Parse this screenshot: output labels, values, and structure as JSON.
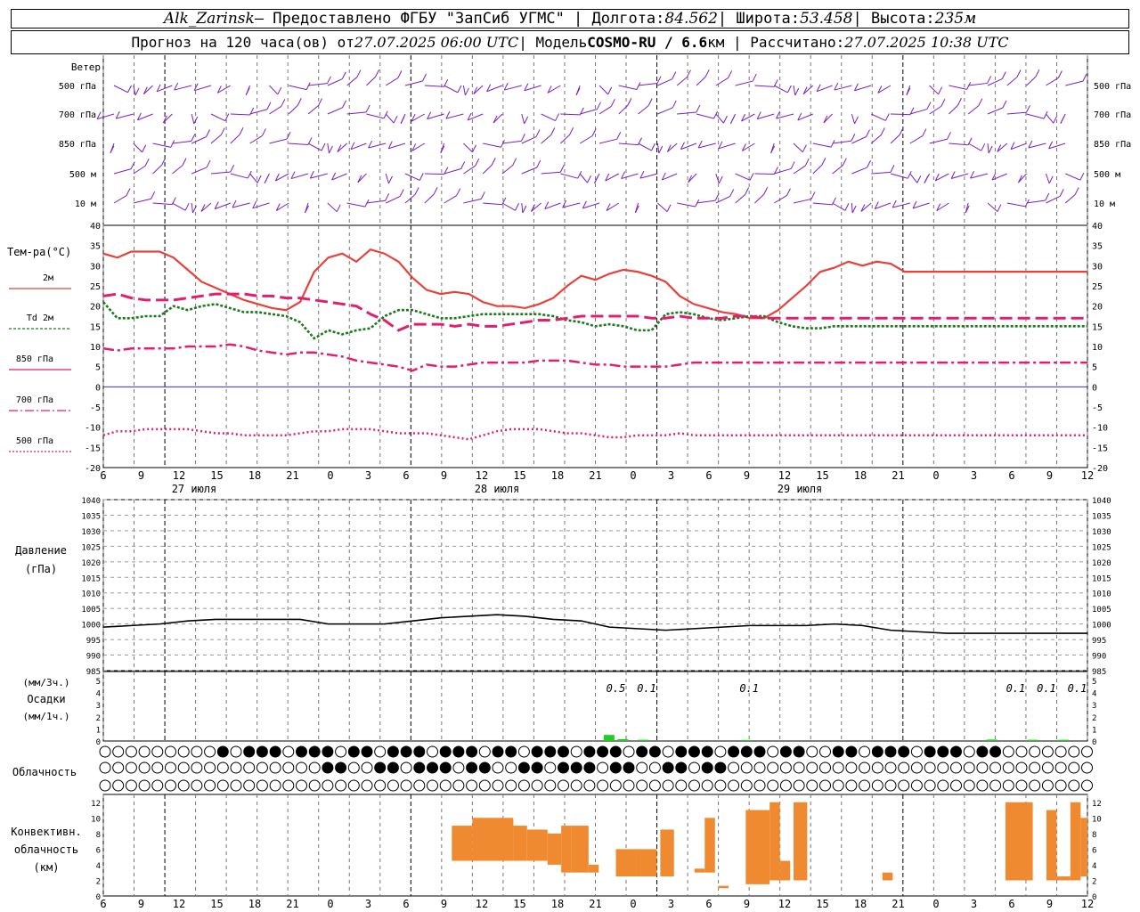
{
  "header": {
    "station": "Alk_Zarinsk",
    "provider": " – Предоставлено ФГБУ \"ЗапСиб УГМС\" | Долгота: ",
    "lon": "84.562",
    "lat_label": " | Широта: ",
    "lat": "53.458",
    "alt_label": " | Высота: ",
    "alt": "235м",
    "forecast_prefix": "Прогноз на 120 часа(ов) от ",
    "forecast_time": "27.07.2025 06:00 UTC",
    "model_label": "  | Модель ",
    "model_name": "COSMO-RU / 6.6",
    "model_suffix": "км | Рассчитано: ",
    "computed_time": "27.07.2025 10:38 UTC"
  },
  "labels": {
    "wind": "Ветер",
    "wind_levels": [
      "500 гПа",
      "700 гПа",
      "850 гПа",
      "500 м",
      "10  м"
    ],
    "temp": "Тем-ра(°С)",
    "temp_series": [
      "2м",
      "Td  2м",
      "850 гПа",
      "700 гПа",
      "500 гПа"
    ],
    "pressure": "Давление",
    "pressure_unit": "(гПа)",
    "precip_top": "(мм/3ч.)",
    "precip": "Осадки",
    "precip_bottom": "(мм/1ч.)",
    "cloud": "Облачность",
    "conv1": "Конвективн.",
    "conv2": "облачность",
    "conv3": "(км)",
    "days": [
      "27 июля",
      "28 июля",
      "29 июля"
    ],
    "hour_ticks": [
      "6",
      "9",
      "12",
      "15",
      "18",
      "21",
      "0",
      "3",
      "6",
      "9",
      "12",
      "15",
      "18",
      "21",
      "0",
      "3",
      "6",
      "9",
      "12",
      "15",
      "18",
      "21",
      "0",
      "3",
      "6",
      "9",
      "12"
    ]
  },
  "colors": {
    "t2m": "#e8413a",
    "td2m": "#1c7a1c",
    "t850": "#e0206e",
    "t700": "#e0206e",
    "t500": "#e0206e",
    "wind": "#7a1fc0",
    "precip": "#22cc22",
    "conv": "#f08a30",
    "zero": "#3333cc"
  },
  "chart_data": [
    {
      "type": "line",
      "title": "Тем-ра(°С)",
      "x_hours_from_start": [
        0,
        3,
        6,
        9,
        12,
        15,
        18,
        21,
        24,
        27,
        30,
        33,
        36,
        39,
        42,
        45,
        48,
        51,
        54,
        57,
        60,
        63,
        66,
        69,
        72,
        75,
        78,
        81,
        84,
        87,
        90,
        93,
        96,
        99,
        102,
        105,
        108,
        111,
        114,
        117,
        120,
        123,
        126,
        129,
        132,
        135,
        138,
        141,
        144,
        147,
        150,
        153,
        156,
        159,
        162,
        165,
        168,
        171,
        174,
        177,
        180,
        183,
        186,
        189,
        192,
        195,
        198,
        201,
        204,
        207,
        210
      ],
      "ylim": [
        -20,
        40
      ],
      "series": [
        {
          "name": "2м",
          "values": [
            33,
            32,
            33.5,
            33.5,
            33.5,
            32,
            29,
            26,
            24.5,
            23,
            21.5,
            20.5,
            19.5,
            19,
            21,
            28.5,
            32,
            33,
            31,
            34,
            33,
            31,
            27,
            24,
            23,
            23.5,
            23,
            21,
            20,
            20,
            19.5,
            20.5,
            22,
            25,
            27.5,
            26.5,
            28,
            29,
            28.5,
            27.5,
            26,
            22.5,
            20.5,
            19.5,
            18.5,
            18,
            17,
            17,
            19,
            22,
            25,
            28.5,
            29.5,
            31,
            30,
            31,
            30.5,
            28.5,
            28.5,
            28.5,
            28.5,
            28.5,
            28.5,
            28.5,
            28.5,
            28.5,
            28.5,
            28.5,
            28.5,
            28.5,
            28.5
          ]
        },
        {
          "name": "Td  2м",
          "values": [
            21,
            17,
            17,
            17.5,
            17.5,
            20,
            19,
            20,
            20.5,
            19.5,
            18.5,
            18.5,
            18,
            17.5,
            16,
            12,
            14,
            13,
            14,
            14.5,
            17.5,
            19,
            19,
            18,
            17,
            17,
            17.5,
            18,
            18,
            18,
            18,
            18,
            17.5,
            16.5,
            16,
            15,
            15.5,
            15,
            14,
            14,
            18,
            18.5,
            18,
            17,
            16.5,
            17,
            17.5,
            17.5,
            16,
            15,
            14.5,
            14.5,
            15,
            15,
            15,
            15,
            15,
            15,
            15,
            15,
            15,
            15,
            15,
            15,
            15,
            15,
            15,
            15,
            15,
            15,
            15
          ]
        },
        {
          "name": "850 гПа",
          "values": [
            22.5,
            23,
            22,
            21.5,
            21.5,
            21.5,
            22,
            22.5,
            23,
            23,
            23,
            22.5,
            22.5,
            22,
            22,
            21.5,
            21,
            20.5,
            20,
            18,
            16.5,
            14,
            15.5,
            15.5,
            15.5,
            15,
            15.5,
            15,
            15,
            15.5,
            16,
            16.5,
            16.5,
            17,
            17.5,
            17.5,
            17.5,
            17.5,
            17.5,
            17,
            17,
            17.5,
            17,
            17,
            17,
            17.5,
            17.5,
            17,
            17,
            17,
            17,
            17,
            17,
            17,
            17,
            17,
            17,
            17,
            17,
            17,
            17,
            17,
            17,
            17,
            17,
            17,
            17,
            17,
            17,
            17,
            17
          ]
        },
        {
          "name": "700 гПа",
          "values": [
            9.5,
            9,
            9.5,
            9.5,
            9.5,
            9.5,
            10,
            10,
            10,
            10.5,
            10,
            9,
            8.5,
            8,
            8.5,
            8.5,
            8,
            7.5,
            6.5,
            6,
            5.5,
            5,
            4,
            5.5,
            5,
            5,
            5.5,
            6,
            6,
            6,
            6,
            6.5,
            6.5,
            6.5,
            6,
            5.5,
            5.5,
            5,
            5,
            5,
            5,
            5.5,
            6,
            6,
            6,
            6,
            6,
            6,
            6,
            6,
            6,
            6,
            6,
            6,
            6,
            6,
            6,
            6,
            6,
            6,
            6,
            6,
            6,
            6,
            6,
            6,
            6,
            6,
            6,
            6,
            6
          ]
        },
        {
          "name": "500 гПа",
          "values": [
            -12,
            -11,
            -11,
            -10.5,
            -10.5,
            -10.5,
            -10.5,
            -11,
            -11.5,
            -11.5,
            -12,
            -12,
            -12,
            -12,
            -11.5,
            -11,
            -11,
            -10.5,
            -10.5,
            -10.5,
            -11,
            -11.5,
            -11.5,
            -11.5,
            -12,
            -12.5,
            -13,
            -12,
            -11,
            -10.5,
            -10.5,
            -10.5,
            -11,
            -11.5,
            -11.5,
            -12,
            -12.5,
            -12.5,
            -12,
            -12,
            -12,
            -11.5,
            -12,
            -12,
            -12,
            -12,
            -12,
            -12,
            -12,
            -12,
            -12,
            -12,
            -12,
            -12,
            -12,
            -12,
            -12,
            -12,
            -12,
            -12,
            -12,
            -12,
            -12,
            -12,
            -12,
            -12,
            -12,
            -12,
            -12,
            -12,
            -12
          ]
        }
      ]
    },
    {
      "type": "line",
      "title": "Давление",
      "ylabel": "(гПа)",
      "ylim": [
        985,
        1040
      ],
      "x_hours_from_start": [
        0,
        6,
        12,
        18,
        24,
        30,
        36,
        42,
        48,
        54,
        60,
        66,
        72,
        78,
        84,
        90,
        96,
        102,
        108,
        114,
        120,
        126,
        132,
        138,
        144,
        150,
        156,
        162,
        168,
        174,
        180,
        186,
        192,
        198,
        204,
        210
      ],
      "values": [
        999,
        999.5,
        1000,
        1001,
        1001.5,
        1001.5,
        1001.5,
        1001.5,
        1000,
        1000,
        1000,
        1001,
        1002,
        1002.5,
        1003,
        1002.5,
        1001.5,
        1001,
        999,
        998.5,
        998,
        998.5,
        999,
        999.5,
        999.5,
        999.5,
        1000,
        999.5,
        998,
        997.5,
        997,
        997,
        997,
        997,
        997,
        997
      ]
    },
    {
      "type": "bar",
      "title": "Осадки",
      "ylim": [
        0,
        5
      ],
      "annotations": [
        {
          "hour": 150,
          "text": "0.5"
        },
        {
          "hour": 159,
          "text": "0.1"
        },
        {
          "hour": 189,
          "text": "0.1"
        },
        {
          "hour": 267,
          "text": "0.1"
        },
        {
          "hour": 276,
          "text": "0.1"
        },
        {
          "hour": 285,
          "text": "0.1"
        }
      ],
      "bars": [
        {
          "hour": 148,
          "value": 0.5
        },
        {
          "hour": 152,
          "value": 0.15
        },
        {
          "hour": 158,
          "value": 0.1
        },
        {
          "hour": 188,
          "value": 0.08
        },
        {
          "hour": 260,
          "value": 0.12
        },
        {
          "hour": 272,
          "value": 0.1
        },
        {
          "hour": 281,
          "value": 0.1
        }
      ]
    },
    {
      "type": "bar",
      "title": "Конвективн. облачность",
      "ylabel": "(км)",
      "ylim": [
        0,
        12
      ],
      "bars": [
        {
          "hour_start": 102,
          "hour_end": 108,
          "bottom": 4.5,
          "top": 9
        },
        {
          "hour_start": 108,
          "hour_end": 120,
          "bottom": 4.5,
          "top": 10
        },
        {
          "hour_start": 120,
          "hour_end": 124,
          "bottom": 4.5,
          "top": 9
        },
        {
          "hour_start": 124,
          "hour_end": 130,
          "bottom": 4.5,
          "top": 8.5
        },
        {
          "hour_start": 130,
          "hour_end": 134,
          "bottom": 4,
          "top": 8
        },
        {
          "hour_start": 134,
          "hour_end": 137,
          "bottom": 3,
          "top": 9
        },
        {
          "hour_start": 137,
          "hour_end": 142,
          "bottom": 3,
          "top": 9
        },
        {
          "hour_start": 142,
          "hour_end": 145,
          "bottom": 3,
          "top": 4
        },
        {
          "hour_start": 150,
          "hour_end": 156,
          "bottom": 2.5,
          "top": 6
        },
        {
          "hour_start": 156,
          "hour_end": 162,
          "bottom": 2.5,
          "top": 6
        },
        {
          "hour_start": 163,
          "hour_end": 167,
          "bottom": 2.5,
          "top": 8.5
        },
        {
          "hour_start": 173,
          "hour_end": 176,
          "bottom": 3,
          "top": 3.5
        },
        {
          "hour_start": 176,
          "hour_end": 179,
          "bottom": 3,
          "top": 10
        },
        {
          "hour_start": 180,
          "hour_end": 183,
          "bottom": 1,
          "top": 1.3
        },
        {
          "hour_start": 188,
          "hour_end": 195,
          "bottom": 1.5,
          "top": 11
        },
        {
          "hour_start": 195,
          "hour_end": 198,
          "bottom": 2,
          "top": 12
        },
        {
          "hour_start": 198,
          "hour_end": 201,
          "bottom": 2,
          "top": 4.5
        },
        {
          "hour_start": 202,
          "hour_end": 206,
          "bottom": 2,
          "top": 12
        },
        {
          "hour_start": 228,
          "hour_end": 231,
          "bottom": 2,
          "top": 3
        },
        {
          "hour_start": 264,
          "hour_end": 272,
          "bottom": 2,
          "top": 12
        },
        {
          "hour_start": 276,
          "hour_end": 279,
          "bottom": 2,
          "top": 11
        },
        {
          "hour_start": 279,
          "hour_end": 283,
          "bottom": 2,
          "top": 2.5
        },
        {
          "hour_start": 283,
          "hour_end": 286,
          "bottom": 2,
          "top": 12
        },
        {
          "hour_start": 286,
          "hour_end": 288,
          "bottom": 2.5,
          "top": 10
        }
      ]
    }
  ]
}
